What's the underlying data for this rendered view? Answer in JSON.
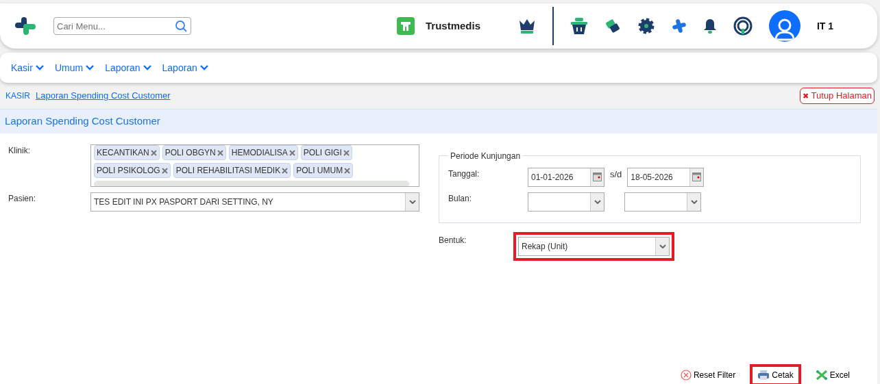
{
  "header": {
    "search": {
      "placeholder": "Cari Menu..."
    },
    "brand": "Trustmedis",
    "user": "IT 1"
  },
  "menu": [
    {
      "label": "Kasir"
    },
    {
      "label": "Umum"
    },
    {
      "label": "Laporan"
    },
    {
      "label": "Laporan"
    }
  ],
  "breadcrumb": {
    "section": "KASIR",
    "page": "Laporan Spending Cost Customer"
  },
  "close_button": {
    "icon": "✖",
    "label": "Tutup Halaman"
  },
  "panel_title": "Laporan Spending Cost Customer",
  "klinik": {
    "label": "Klinik:",
    "tags": [
      "KECANTIKAN",
      "POLI OBGYN",
      "HEMODIALISA",
      "POLI GIGI",
      "POLI PSIKOLOG",
      "POLI REHABILITASI MEDIK",
      "POLI UMUM"
    ]
  },
  "pasien": {
    "label": "Pasien:",
    "value": "TES EDIT INI PX PASPORT DARI SETTING, NY"
  },
  "periode": {
    "legend": "Periode Kunjungan",
    "tanggal": {
      "label": "Tanggal:",
      "from": "01-01-2026",
      "separator": "s/d",
      "to": "18-05-2026"
    },
    "bulan": {
      "label": "Bulan:"
    }
  },
  "bentuk": {
    "label": "Bentuk:",
    "value": "Rekap (Unit)",
    "highlighted": true
  },
  "actions": [
    {
      "label": "Reset Filter",
      "kind": "reset",
      "highlighted": false
    },
    {
      "label": "Cetak",
      "kind": "print",
      "highlighted": true
    },
    {
      "label": "Excel",
      "kind": "excel",
      "highlighted": false
    }
  ]
}
